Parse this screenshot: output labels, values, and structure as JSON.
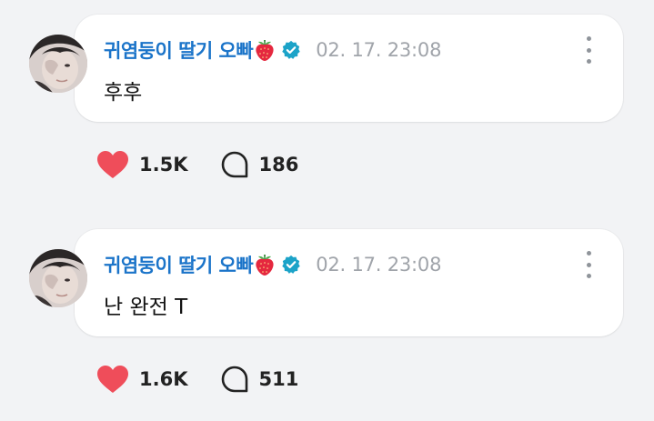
{
  "colors": {
    "author": "#1b74c9",
    "timestamp": "#a0a4aa",
    "heart": "#ef4d5a",
    "verified": "#1ca3c8",
    "background": "#f2f3f5"
  },
  "posts": [
    {
      "author": "귀염둥이 딸기 오빠",
      "author_emoji": "strawberry",
      "verified": true,
      "timestamp": "02. 17. 23:08",
      "text": "후후",
      "likes": "1.5K",
      "comments": "186"
    },
    {
      "author": "귀염둥이 딸기 오빠",
      "author_emoji": "strawberry",
      "verified": true,
      "timestamp": "02. 17. 23:08",
      "text": "난 완전 T",
      "likes": "1.6K",
      "comments": "511"
    }
  ]
}
